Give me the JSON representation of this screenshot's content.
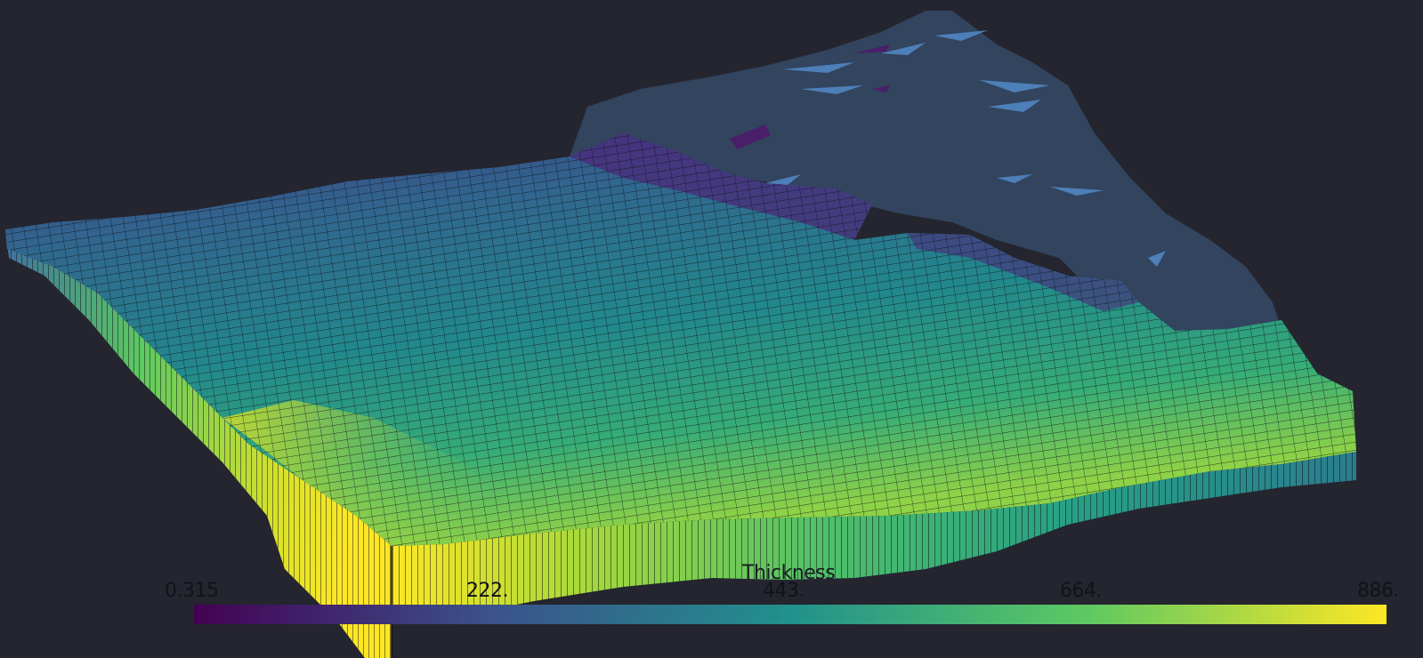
{
  "scalar_bar": {
    "title": "Thickness",
    "tick_labels": [
      "0.315",
      "222.",
      "443.",
      "664.",
      "886."
    ],
    "range": [
      0.315,
      886
    ],
    "colormap": "viridis",
    "colors": [
      "#440154",
      "#3b528b",
      "#21918c",
      "#5ec962",
      "#fde725"
    ]
  },
  "scene": {
    "background": "#24252f",
    "base_surface_color": "#32445e",
    "mesh_line_color": "#0b0d12",
    "surface": "gridded terrain mesh colored by Thickness, rendered with edges"
  }
}
